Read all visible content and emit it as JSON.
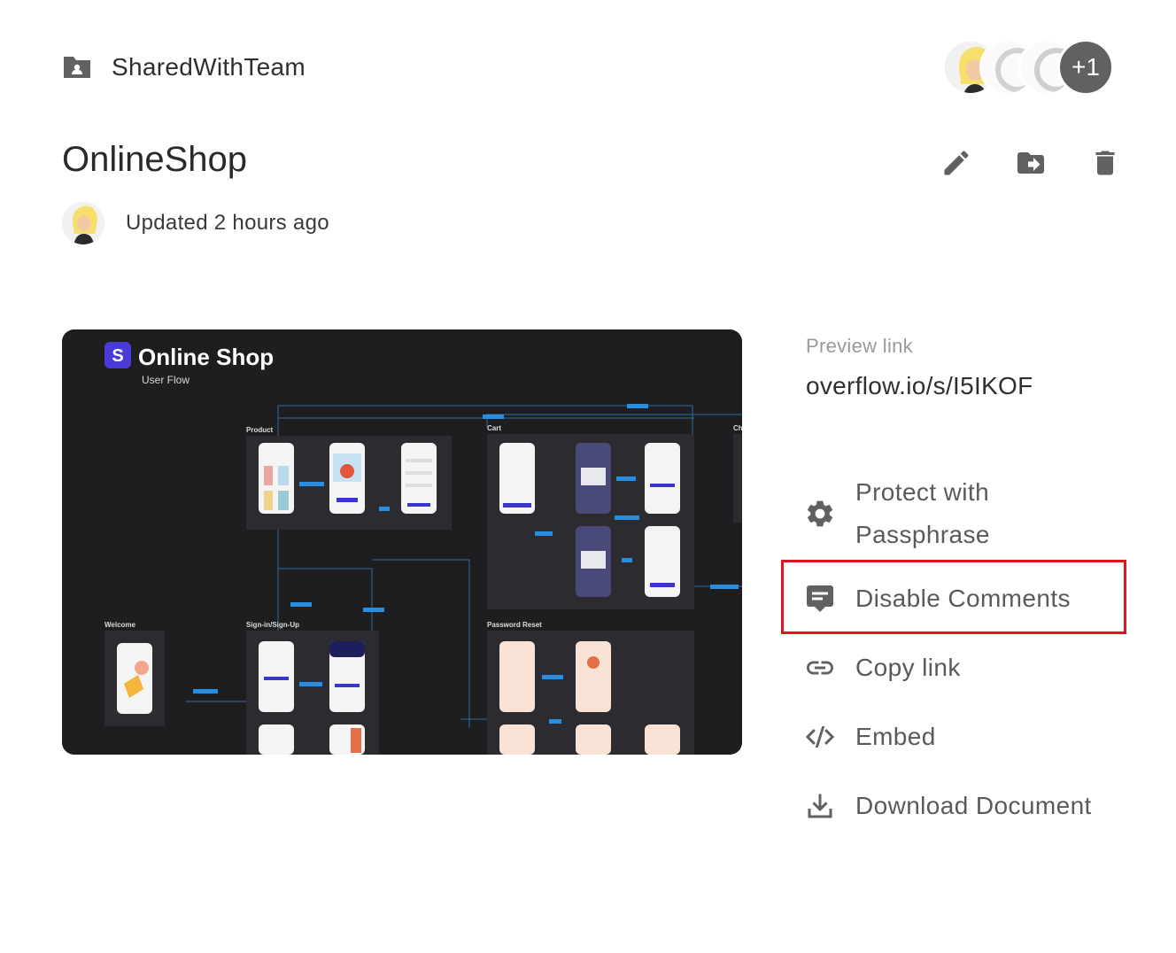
{
  "folder": {
    "name": "SharedWithTeam"
  },
  "collaborators": {
    "more_label": "+1"
  },
  "document": {
    "title": "OnlineShop",
    "updated": "Updated 2 hours ago"
  },
  "preview_image": {
    "title": "Online Shop",
    "subtitle": "User Flow",
    "logo_letter": "S",
    "sections": {
      "product": "Product",
      "cart": "Cart",
      "welcome": "Welcome",
      "signin": "Sign-in/Sign-Up",
      "password": "Password Reset",
      "checkout": "Ch"
    }
  },
  "preview_link": {
    "label": "Preview link",
    "url": "overflow.io/s/I5IKOF"
  },
  "menu": {
    "protect": "Protect with Passphrase",
    "disable_comments": "Disable Comments",
    "copy_link": "Copy link",
    "embed": "Embed",
    "download": "Download Document"
  },
  "colors": {
    "highlight": "#e0141e",
    "icon_gray": "#616161",
    "preview_bg": "#1e1e21"
  }
}
